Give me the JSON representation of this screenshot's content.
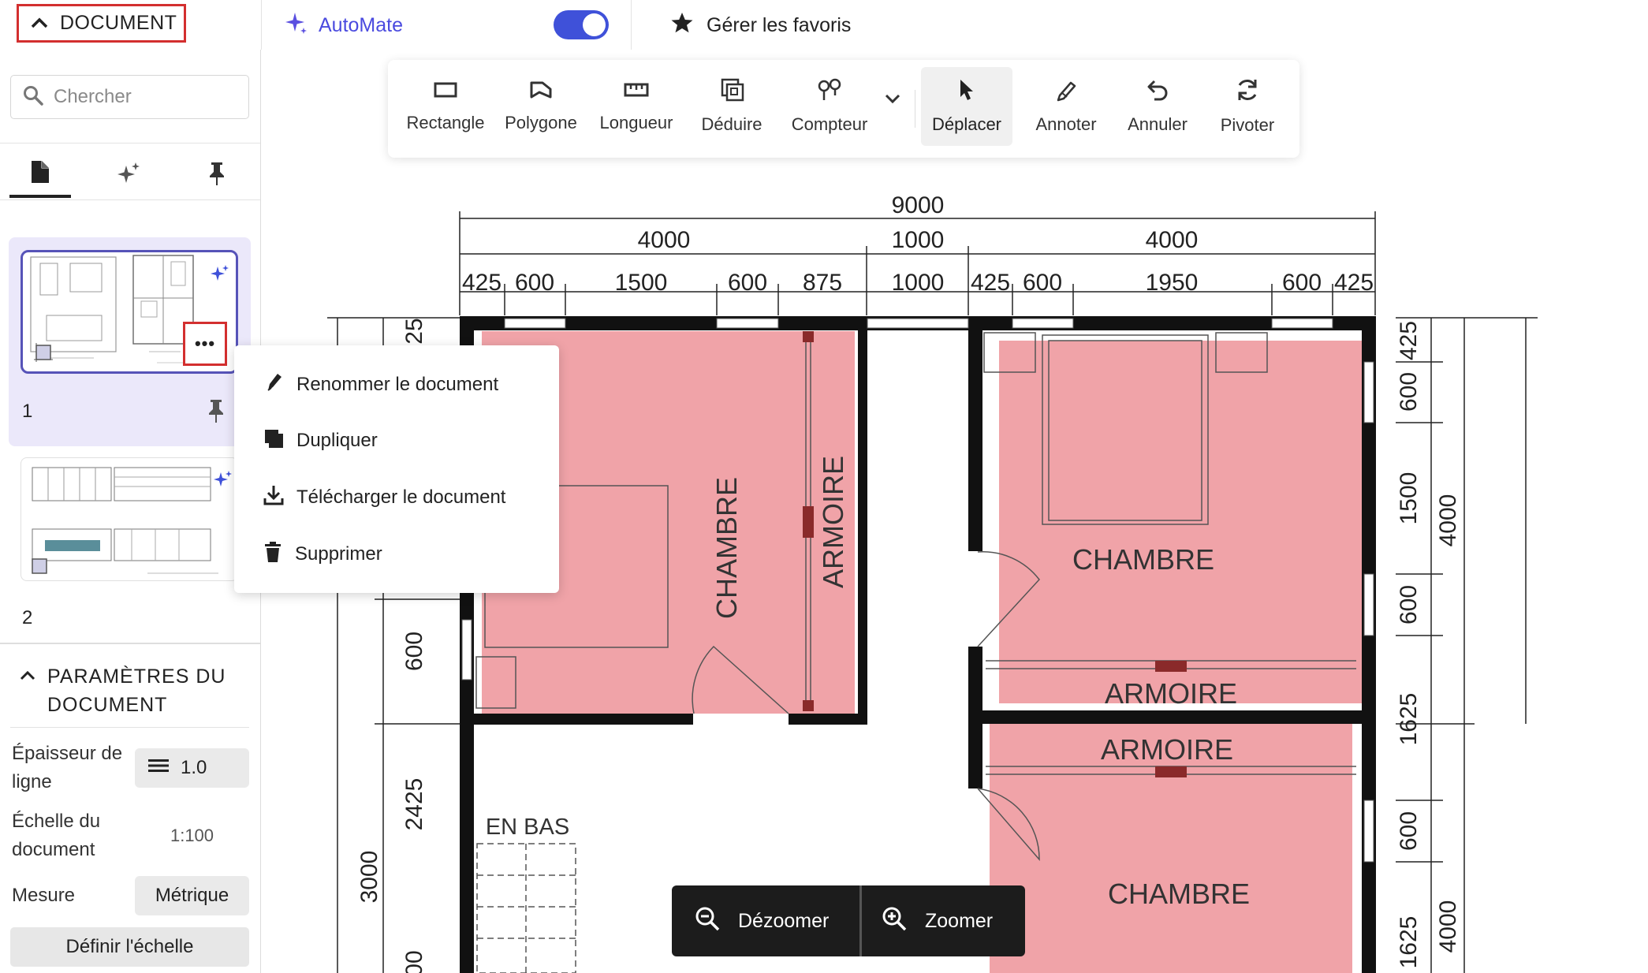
{
  "topbar": {
    "document_label": "DOCUMENT",
    "automate_label": "AutoMate",
    "automate_enabled": true,
    "favorites_label": "Gérer les favoris"
  },
  "sidebar": {
    "search_placeholder": "Chercher",
    "tabs": [
      {
        "icon": "document-icon",
        "active": true
      },
      {
        "icon": "sparkle-icon",
        "active": false
      },
      {
        "icon": "pin-icon",
        "active": false
      }
    ],
    "pages": [
      {
        "number": "1",
        "selected": true
      },
      {
        "number": "2",
        "selected": false
      }
    ],
    "more_label": "•••",
    "settings": {
      "title": "PARAMÈTRES DU DOCUMENT",
      "line_thickness_label": "Épaisseur de ligne",
      "line_thickness_value": "1.0",
      "scale_label": "Échelle du document",
      "scale_value": "1:100",
      "measure_label": "Mesure",
      "measure_value": "Métrique",
      "set_scale_button": "Définir l'échelle"
    }
  },
  "toolbar": {
    "tools": [
      {
        "label": "Rectangle",
        "icon": "rectangle-icon"
      },
      {
        "label": "Polygone",
        "icon": "polygon-icon"
      },
      {
        "label": "Longueur",
        "icon": "ruler-icon"
      },
      {
        "label": "Déduire",
        "icon": "deduct-icon"
      },
      {
        "label": "Compteur",
        "icon": "counter-icon"
      },
      {
        "label": "Déplacer",
        "icon": "cursor-icon",
        "active": true
      },
      {
        "label": "Annoter",
        "icon": "annotate-icon"
      },
      {
        "label": "Annuler",
        "icon": "undo-icon"
      },
      {
        "label": "Pivoter",
        "icon": "rotate-icon"
      }
    ]
  },
  "context_menu": {
    "items": [
      {
        "label": "Renommer le document",
        "icon": "pencil-icon"
      },
      {
        "label": "Dupliquer",
        "icon": "duplicate-icon"
      },
      {
        "label": "Télécharger le document",
        "icon": "download-icon"
      },
      {
        "label": "Supprimer",
        "icon": "trash-icon"
      }
    ]
  },
  "zoom": {
    "zoom_out_label": "Dézoomer",
    "zoom_in_label": "Zoomer"
  },
  "plan": {
    "top_total": "9000",
    "top_mid": [
      "4000",
      "1000",
      "4000"
    ],
    "top_detail": [
      "425",
      "600",
      "1500",
      "600",
      "875",
      "1000",
      "425",
      "600",
      "1950",
      "600",
      "425"
    ],
    "right_inner": [
      "425",
      "600",
      "1500",
      "600",
      "1625",
      "600",
      "1625"
    ],
    "right_outer": [
      "4000",
      "4000"
    ],
    "left_inner": [
      "25",
      "600",
      "2425",
      "00"
    ],
    "left_outer": [
      "3000"
    ],
    "rooms": {
      "chambre_1": "CHAMBRE",
      "armoire_1": "ARMOIRE",
      "chambre_2": "CHAMBRE",
      "armoire_2": "ARMOIRE",
      "armoire_3": "ARMOIRE",
      "chambre_3": "CHAMBRE",
      "stairs": "EN BAS"
    },
    "highlight_color": "#f0a3a8"
  }
}
